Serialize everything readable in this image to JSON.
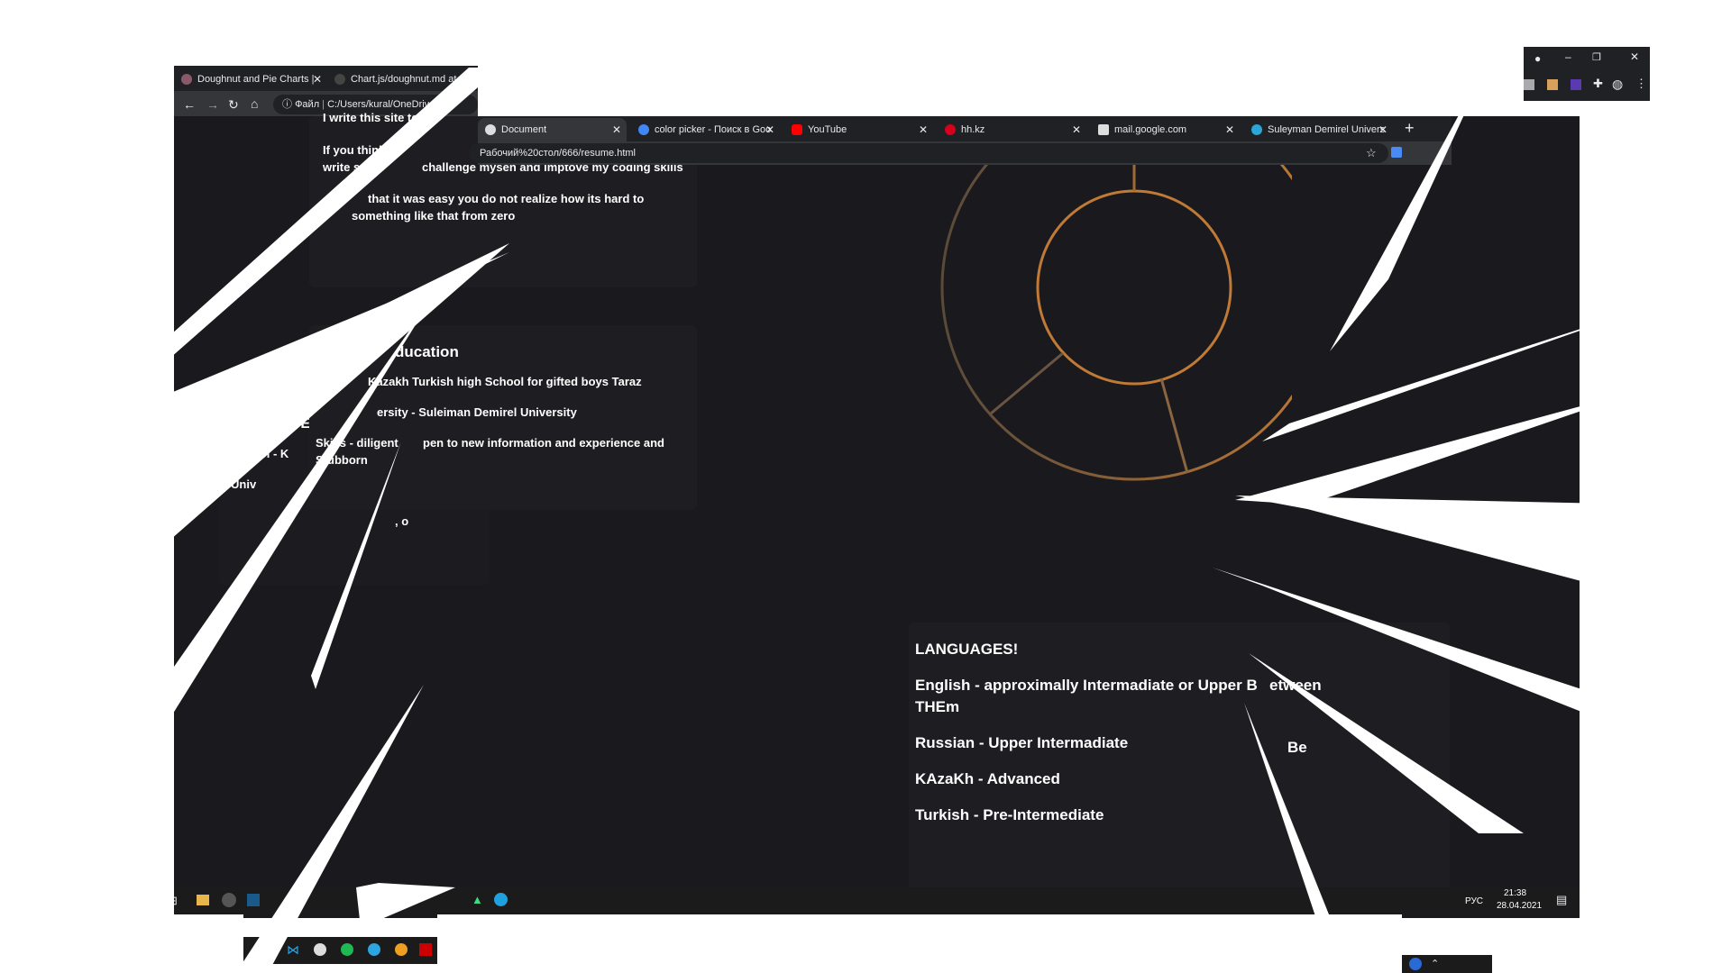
{
  "back_window": {
    "tabs": [
      {
        "label": "Doughnut and Pie Charts |"
      },
      {
        "label": "Chart.js/doughnut.md at m"
      }
    ],
    "omnibox_label": "Файл",
    "omnibox_url": "C:/Users/kural/OneDrive/"
  },
  "front_window": {
    "tabs": [
      {
        "label": "Document"
      },
      {
        "label": "color picker - Поиск в Goo"
      },
      {
        "label": "YouTube"
      },
      {
        "label": "hh.kz"
      },
      {
        "label": "mail.google.com"
      },
      {
        "label": "Suleyman Demirel Univers"
      }
    ],
    "new_tab": "+",
    "url": "Рабочий%20стол/666/resume.html"
  },
  "page": {
    "about_lines": [
      "I write this site to",
      "If you think",
      "write so",
      "challenge mysen and imptove my coding skills",
      "that it was easy you do not realize how its hard to",
      "something like that from zero"
    ],
    "education": {
      "heading": "ducation",
      "lines": [
        "Kazakh Turkish high School for gifted boys Taraz",
        "ersity - Suleiman Demirel University",
        "Skills - diligent",
        "pen to new information and experience and",
        "Stubborn"
      ]
    },
    "about_my": {
      "heading": "About My E",
      "school": "School - K",
      "univ": "Univ",
      "frag": ", o"
    },
    "languages": {
      "heading": "LANGUAGES!",
      "items": [
        "English - approximally Intermadiate or Upper B",
        "etween",
        "THEm",
        "Russian - Upper Intermadiate",
        "KAzaKh - Advanced",
        "Turkish - Pre-Intermediate"
      ],
      "frag": "Be"
    }
  },
  "taskbar": {
    "lang": "РУС",
    "time": "21:38",
    "date": "28.04.2021"
  },
  "colors": {
    "accent_ring": "#c07a35",
    "page_bg": "#1a1a1e",
    "chrome_bg": "#202124"
  }
}
